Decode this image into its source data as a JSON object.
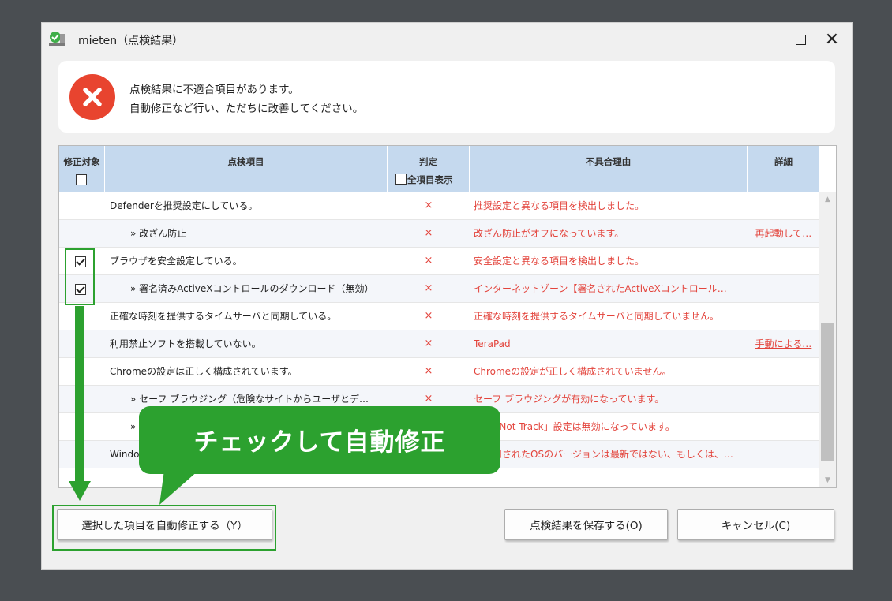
{
  "window": {
    "title": "mieten（点検結果）",
    "maximize_icon": "maximize-icon",
    "close_symbol": "✕"
  },
  "message": {
    "icon": "error-icon",
    "line1": "点検結果に不適合項目があります。",
    "line2": "自動修正など行い、ただちに改善してください。"
  },
  "table": {
    "headers": {
      "fix": "修正対象",
      "item": "点検項目",
      "judge": "判定",
      "show_all": "全項目表示",
      "reason": "不具合理由",
      "detail": "詳細"
    },
    "rows": [
      {
        "item": "Defenderを推奨設定にしている。",
        "judge": "×",
        "reason": "推奨設定と異なる項目を検出しました。",
        "detail": "",
        "sub": false,
        "checkbox": false,
        "checked": false
      },
      {
        "item": "» 改ざん防止",
        "judge": "×",
        "reason": "改ざん防止がオフになっています。",
        "detail": "再起動して…",
        "sub": true,
        "checkbox": false,
        "checked": false
      },
      {
        "item": "ブラウザを安全設定している。",
        "judge": "×",
        "reason": "安全設定と異なる項目を検出しました。",
        "detail": "",
        "sub": false,
        "checkbox": true,
        "checked": true
      },
      {
        "item": "» 署名済みActiveXコントロールのダウンロード（無効）",
        "judge": "×",
        "reason": "インターネットゾーン【署名されたActiveXコントロール…",
        "detail": "",
        "sub": true,
        "checkbox": true,
        "checked": true
      },
      {
        "item": "正確な時刻を提供するタイムサーバと同期している。",
        "judge": "×",
        "reason": "正確な時刻を提供するタイムサーバと同期していません。",
        "detail": "",
        "sub": false,
        "checkbox": false,
        "checked": false
      },
      {
        "item": "利用禁止ソフトを搭載していない。",
        "judge": "×",
        "reason": "TeraPad",
        "detail": "手動による…",
        "sub": false,
        "checkbox": false,
        "checked": false,
        "link": true
      },
      {
        "item": "Chromeの設定は正しく構成されています。",
        "judge": "×",
        "reason": "Chromeの設定が正しく構成されていません。",
        "detail": "",
        "sub": false,
        "checkbox": false,
        "checked": false
      },
      {
        "item": "» セーフ ブラウジング（危険なサイトからユーザとデ…",
        "judge": "×",
        "reason": "セーフ ブラウジングが有効になっています。",
        "detail": "",
        "sub": true,
        "checkbox": false,
        "checked": false
      },
      {
        "item": "»",
        "judge": "×",
        "reason": "「Do Not Track」設定は無効になっています。",
        "detail": "",
        "sub": true,
        "checkbox": false,
        "checked": false
      },
      {
        "item": "Windo",
        "judge": "×",
        "reason": "ご使用されたOSのバージョンは最新ではない、もしくは、…",
        "detail": "",
        "sub": false,
        "checkbox": false,
        "checked": false
      }
    ]
  },
  "buttons": {
    "auto_fix": "選択した項目を自動修正する（Y）",
    "save": "点検結果を保存する(O)",
    "cancel": "キャンセル(C)"
  },
  "annotation": {
    "callout": "チェックして自動修正",
    "color": "#2ca12f"
  },
  "colors": {
    "header_bg": "#c5d9ee",
    "error_red": "#e3443c"
  }
}
